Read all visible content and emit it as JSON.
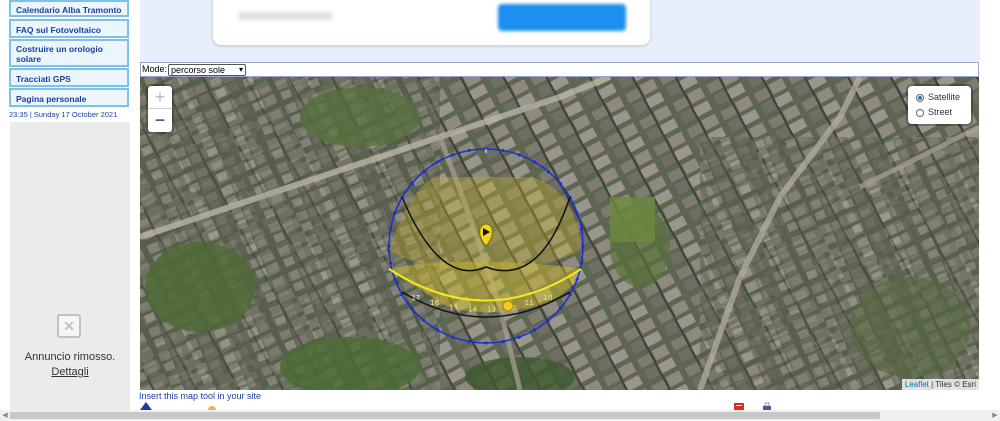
{
  "sidebar": {
    "items": [
      {
        "label": "Calendario Alba Tramonto"
      },
      {
        "label": "FAQ sul Fotovoltaico"
      },
      {
        "label": "Costruire un orologio solare"
      },
      {
        "label": "Tracciati GPS"
      },
      {
        "label": "Pagina personale"
      }
    ],
    "clock": "23:35 | Sunday 17 October 2021"
  },
  "ad": {
    "removed_text": "Annuncio rimosso.",
    "details_link": "Dettagli"
  },
  "mode_bar": {
    "label": "Mode:",
    "selected": "percorso sole"
  },
  "map": {
    "zoom_in": "+",
    "zoom_out": "−",
    "layers": [
      {
        "label": "Satellite",
        "selected": true
      },
      {
        "label": "Street",
        "selected": false
      }
    ],
    "attribution_link": "Leaflet",
    "attribution_rest": " | Tiles © Esri",
    "hour_labels": [
      "17",
      "16",
      "15",
      "14",
      "13",
      "12",
      "11",
      "10"
    ],
    "colors": {
      "outer_ring": "#1c2fd6",
      "day_arc": "#f2ea1c",
      "shadow_fill": "#c9b62a",
      "black_arc": "#111111"
    }
  },
  "footer": {
    "insert_link": "Insert this map tool in your site"
  }
}
